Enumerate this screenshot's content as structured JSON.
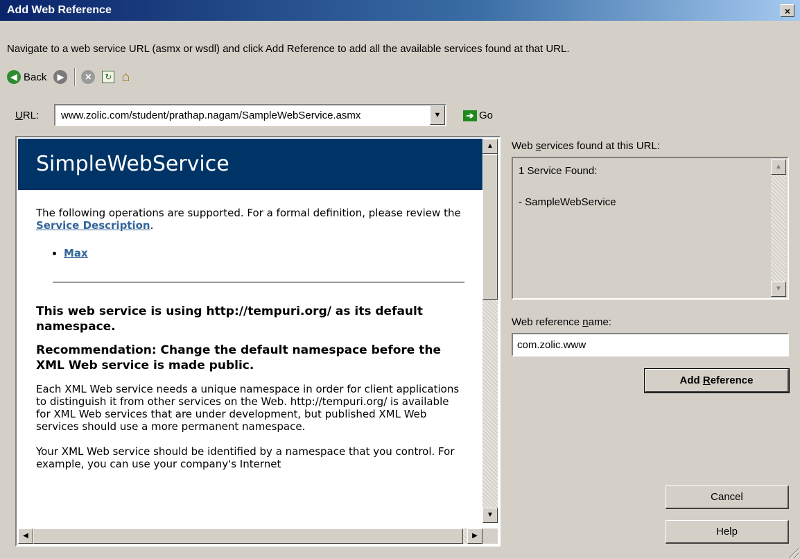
{
  "window": {
    "title": "Add Web Reference",
    "close_glyph": "×"
  },
  "instructions": "Navigate to a web service URL (asmx or wsdl) and click Add Reference to add all the available services found at that URL.",
  "toolbar": {
    "back_label": "Back",
    "back_icon": "back-arrow-icon",
    "forward_icon": "forward-arrow-icon",
    "stop_icon": "stop-icon",
    "refresh_icon": "refresh-icon",
    "home_icon": "home-icon"
  },
  "url": {
    "label_prefix": "",
    "label_u": "U",
    "label_rest": "RL:",
    "value": "www.zolic.com/student/prathap.nagam/SampleWebService.asmx",
    "go_label": "Go"
  },
  "browser": {
    "service_title": "SimpleWebService",
    "intro_text": "The following operations are supported. For a formal definition, please review the ",
    "service_description_link": "Service Description",
    "intro_end": ".",
    "operations": [
      "Max"
    ],
    "namespace_heading": "This web service is using http://tempuri.org/ as its default namespace.",
    "recommendation_heading": "Recommendation: Change the default namespace before the XML Web service is made public.",
    "paragraph1": "Each XML Web service needs a unique namespace in order for client applications to distinguish it from other services on the Web. http://tempuri.org/ is available for XML Web services that are under development, but published XML Web services should use a more permanent namespace.",
    "paragraph2": "Your XML Web service should be identified by a namespace that you control. For example, you can use your company's Internet"
  },
  "found": {
    "label_prefix": "Web ",
    "label_u": "s",
    "label_rest": "ervices found at this URL:",
    "count_text": "1 Service Found:",
    "service_item": "- SampleWebService"
  },
  "refname": {
    "label_prefix": "Web reference ",
    "label_u": "n",
    "label_rest": "ame:",
    "value": "com.zolic.www"
  },
  "buttons": {
    "add_reference_prefix": "Add ",
    "add_reference_u": "R",
    "add_reference_rest": "eference",
    "cancel": "Cancel",
    "help": "Help"
  },
  "colors": {
    "titlebar_start": "#0a246a",
    "service_header_bg": "#003366",
    "link": "#336699",
    "dialog_bg": "#d4d0c8"
  }
}
